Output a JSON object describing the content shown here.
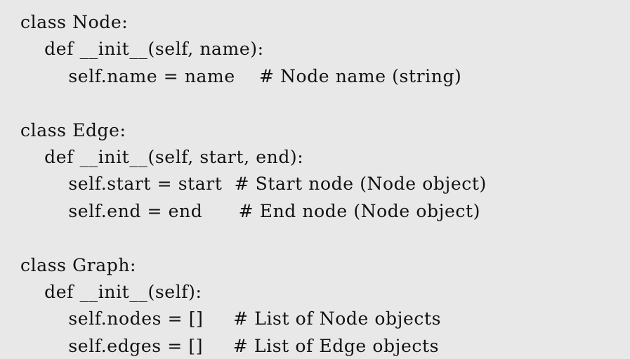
{
  "code": {
    "lines": [
      "class Node:",
      "    def __init__(self, name):",
      "        self.name = name    # Node name (string)",
      "",
      "class Edge:",
      "    def __init__(self, start, end):",
      "        self.start = start  # Start node (Node object)",
      "        self.end = end      # End node (Node object)",
      "",
      "class Graph:",
      "    def __init__(self):",
      "        self.nodes = []     # List of Node objects",
      "        self.edges = []     # List of Edge objects"
    ]
  }
}
